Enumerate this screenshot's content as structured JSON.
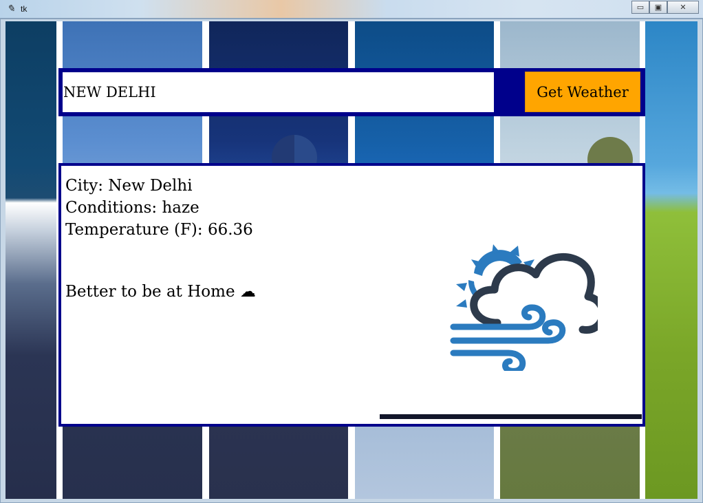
{
  "window": {
    "title": "tk",
    "minimize_glyph": "▭",
    "maximize_glyph": "▣",
    "close_glyph": "✕"
  },
  "search": {
    "city_value": "NEW DELHI",
    "button_label": "Get Weather"
  },
  "result": {
    "city_line": "City: New Delhi",
    "conditions_line": "Conditions: haze",
    "temperature_line": "Temperature (F): 66.36",
    "advice": "Better to be at Home ☁",
    "weather_icon": "partly-cloudy-windy-icon"
  },
  "colors": {
    "panel_border": "#00008b",
    "button_bg": "#ffa500",
    "icon_blue": "#2b7bbf",
    "icon_dark": "#2d3a4b"
  }
}
